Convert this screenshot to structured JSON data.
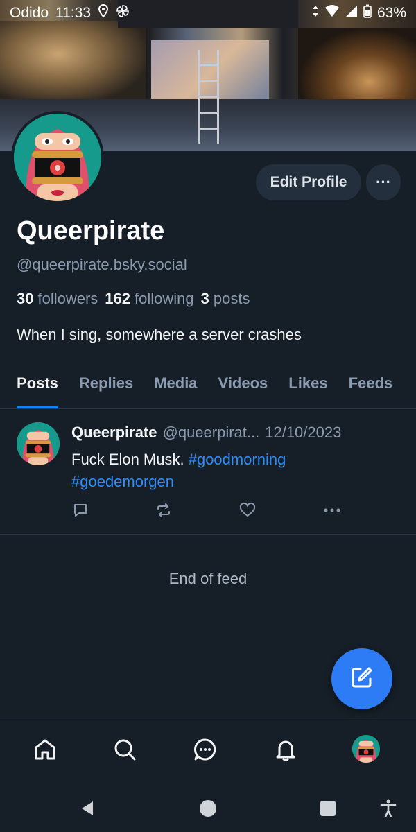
{
  "status_bar": {
    "carrier": "Odido",
    "time": "11:33",
    "battery": "63%"
  },
  "profile": {
    "display_name": "Queerpirate",
    "handle": "@queerpirate.bsky.social",
    "followers_count": "30",
    "followers_label": "followers",
    "following_count": "162",
    "following_label": "following",
    "posts_count": "3",
    "posts_label": "posts",
    "bio": "When I sing, somewhere a server crashes",
    "edit_label": "Edit Profile",
    "more_label": "···"
  },
  "tabs": [
    {
      "label": "Posts",
      "active": true
    },
    {
      "label": "Replies"
    },
    {
      "label": "Media"
    },
    {
      "label": "Videos"
    },
    {
      "label": "Likes"
    },
    {
      "label": "Feeds"
    }
  ],
  "post": {
    "author": "Queerpirate",
    "handle": "@queerpirat...",
    "date": "12/10/2023",
    "text": "Fuck Elon Musk. ",
    "tag1": "#goodmorning",
    "tag2": "#goedemorgen"
  },
  "feed_end": "End of feed",
  "colors": {
    "background": "#161e27",
    "accent": "#1083fe",
    "fab": "#2d7cf6",
    "link": "#2f8cf8",
    "muted": "#8b9bb0"
  },
  "icons": {
    "post_actions": [
      "reply-icon",
      "repost-icon",
      "like-icon",
      "more-icon"
    ],
    "bottom_nav": [
      "home-icon",
      "search-icon",
      "chat-icon",
      "bell-icon",
      "profile-avatar"
    ],
    "system_nav": [
      "back-icon",
      "home-circle-icon",
      "recents-icon",
      "accessibility-icon"
    ]
  }
}
